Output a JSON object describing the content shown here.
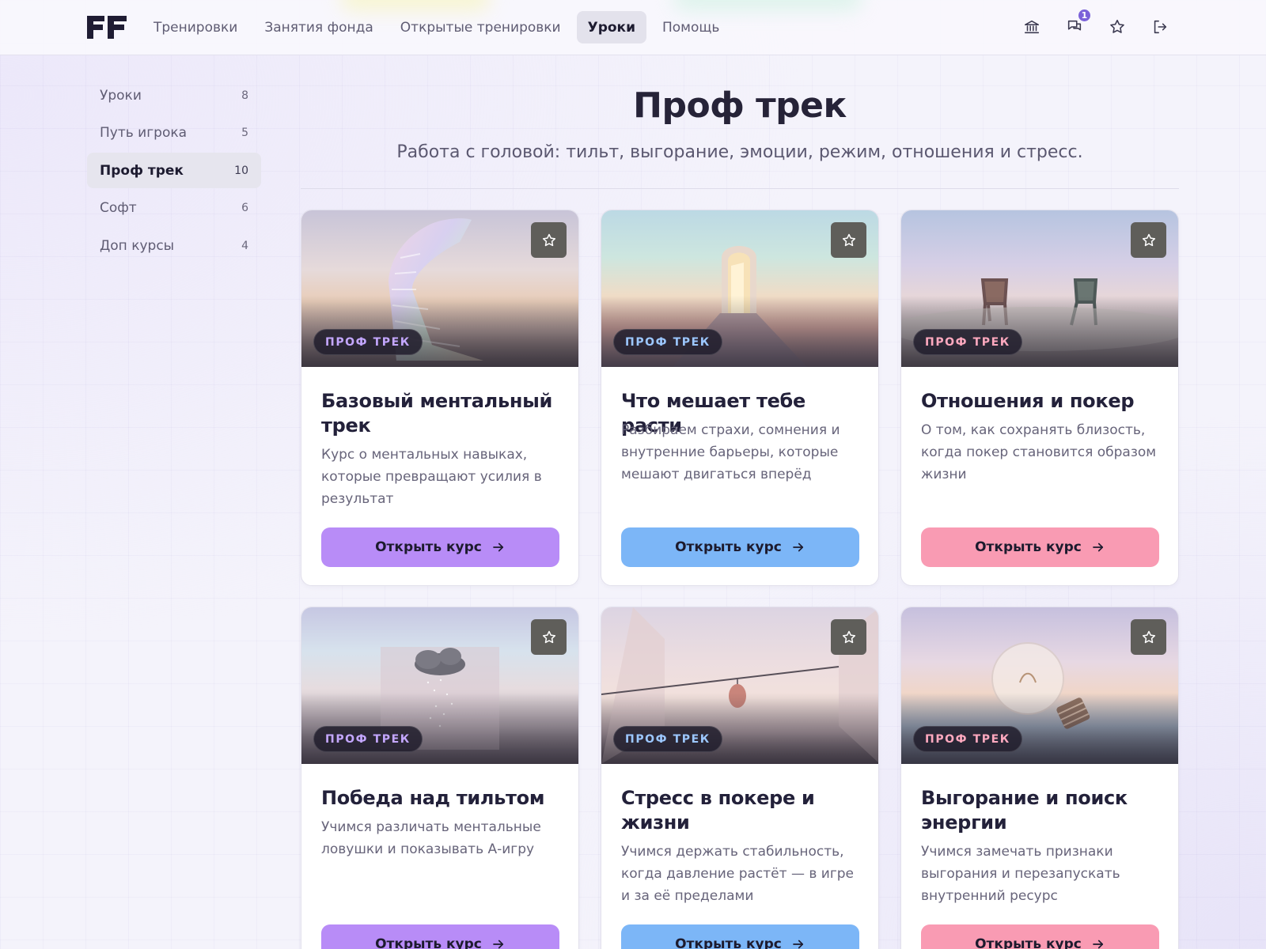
{
  "app": {
    "logo_text": "FF"
  },
  "nav": {
    "items": [
      {
        "label": "Тренировки"
      },
      {
        "label": "Занятия фонда"
      },
      {
        "label": "Открытые тренировки"
      },
      {
        "label": "Уроки",
        "active": true
      },
      {
        "label": "Помощь"
      }
    ]
  },
  "top_actions": {
    "bank_icon": "bank-icon",
    "messages_icon": "messages-icon",
    "messages_badge": "1",
    "favorites_icon": "star-icon",
    "logout_icon": "logout-icon"
  },
  "sidebar": {
    "items": [
      {
        "label": "Уроки",
        "count": "8"
      },
      {
        "label": "Путь игрока",
        "count": "5"
      },
      {
        "label": "Проф трек",
        "count": "10",
        "active": true
      },
      {
        "label": "Софт",
        "count": "6"
      },
      {
        "label": "Доп курсы",
        "count": "4"
      }
    ]
  },
  "page": {
    "title": "Проф трек",
    "subtitle": "Работа с головой: тильт, выгорание, эмоции, режим, отношения и стресс."
  },
  "cards": [
    {
      "tag": "ПРОФ ТРЕК",
      "title": "Базовый ментальный трек",
      "description": "Курс о ментальных навыках, которые превращают усилия в результат",
      "button": "Открыть курс",
      "accent": "#b88cf7"
    },
    {
      "tag": "ПРОФ ТРЕК",
      "title": "Что мешает тебе расти",
      "description": "Разбираем страхи, сомнения и внутренние барьеры, которые мешают двигаться вперёд",
      "button": "Открыть курс",
      "accent": "#7cb6f7"
    },
    {
      "tag": "ПРОФ ТРЕК",
      "title": "Отношения и покер",
      "description": "О том, как сохранять близость, когда покер становится образом жизни",
      "button": "Открыть курс",
      "accent": "#f99bb3"
    },
    {
      "tag": "ПРОФ ТРЕК",
      "title": "Победа над тильтом",
      "description": "Учимся различать ментальные ловушки и показывать А-игру",
      "button": "Открыть курс",
      "accent": "#b88cf7"
    },
    {
      "tag": "ПРОФ ТРЕК",
      "title": "Стресс в покере и жизни",
      "description": "Учимся держать стабильность, когда давление растёт — в игре и за её пределами",
      "button": "Открыть курс",
      "accent": "#7cb6f7"
    },
    {
      "tag": "ПРОФ ТРЕК",
      "title": "Выгорание и поиск энергии",
      "description": "Учимся замечать признаки выгорания и перезапускать внутренний ресурс",
      "button": "Открыть курс",
      "accent": "#f99bb3"
    }
  ]
}
